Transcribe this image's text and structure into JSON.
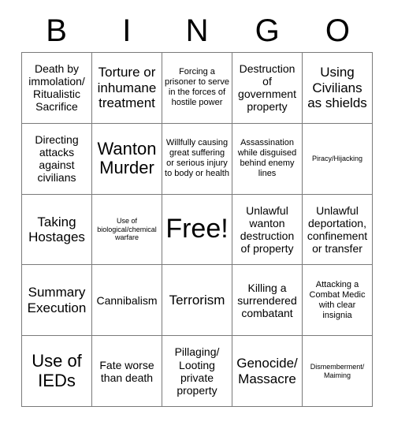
{
  "header": {
    "letters": [
      "B",
      "I",
      "N",
      "G",
      "O"
    ]
  },
  "grid": {
    "rows": 5,
    "columns": 5,
    "cells": [
      {
        "text": "Death by immolation/ Ritualistic Sacrifice",
        "size": "md"
      },
      {
        "text": "Torture or inhumane treatment",
        "size": "lg"
      },
      {
        "text": "Forcing a prisoner to serve in the forces of hostile power",
        "size": "sm"
      },
      {
        "text": "Destruction of government property",
        "size": "md"
      },
      {
        "text": "Using Civilians as shields",
        "size": "lg"
      },
      {
        "text": "Directing attacks against civilians",
        "size": "md"
      },
      {
        "text": "Wanton Murder",
        "size": "xl"
      },
      {
        "text": "Willfully causing great suffering or serious injury to body or health",
        "size": "sm"
      },
      {
        "text": "Assassination while disguised behind enemy lines",
        "size": "sm"
      },
      {
        "text": "Piracy/Hijacking",
        "size": "xs"
      },
      {
        "text": "Taking Hostages",
        "size": "lg"
      },
      {
        "text": "Use of biological/chemical warfare",
        "size": "xs"
      },
      {
        "text": "Free!",
        "size": "xxl"
      },
      {
        "text": "Unlawful wanton destruction of property",
        "size": "md"
      },
      {
        "text": "Unlawful deportation, confinement or transfer",
        "size": "md"
      },
      {
        "text": "Summary Execution",
        "size": "lg"
      },
      {
        "text": "Cannibalism",
        "size": "md"
      },
      {
        "text": "Terrorism",
        "size": "lg"
      },
      {
        "text": "Killing a surrendered combatant",
        "size": "md"
      },
      {
        "text": "Attacking a Combat Medic with clear insignia",
        "size": "sm"
      },
      {
        "text": "Use of IEDs",
        "size": "xl"
      },
      {
        "text": "Fate worse than death",
        "size": "md"
      },
      {
        "text": "Pillaging/ Looting private property",
        "size": "md"
      },
      {
        "text": "Genocide/ Massacre",
        "size": "lg"
      },
      {
        "text": "Dismemberment/ Maiming",
        "size": "xs"
      }
    ]
  },
  "colors": {
    "border": "#7a7a7a",
    "text": "#000000",
    "background": "#ffffff"
  }
}
